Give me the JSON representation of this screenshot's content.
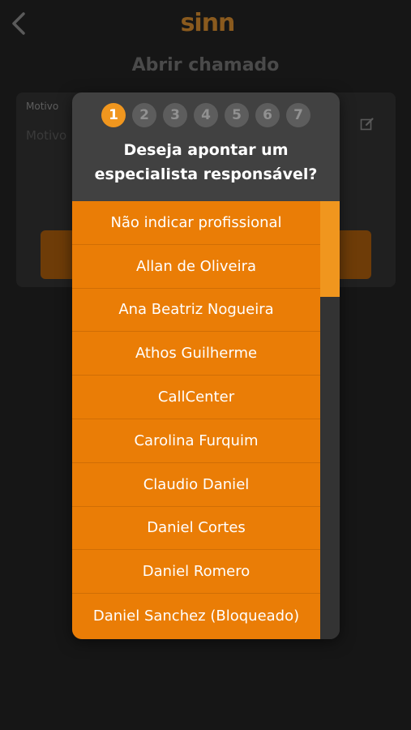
{
  "app": {
    "logo_text": "sinn",
    "page_title": "Abrir chamado"
  },
  "form": {
    "motivo_label": "Motivo",
    "motivo_placeholder": "Motivo"
  },
  "modal": {
    "steps": [
      {
        "label": "1",
        "active": true
      },
      {
        "label": "2",
        "active": false
      },
      {
        "label": "3",
        "active": false
      },
      {
        "label": "4",
        "active": false
      },
      {
        "label": "5",
        "active": false
      },
      {
        "label": "6",
        "active": false
      },
      {
        "label": "7",
        "active": false
      }
    ],
    "question_line1": "Deseja apontar um",
    "question_line2": "especialista responsável?",
    "options": [
      "Não indicar profissional",
      "Allan de Oliveira",
      "Ana Beatriz Nogueira",
      "Athos Guilherme",
      "CallCenter",
      "Carolina Furquim",
      "Claudio Daniel",
      "Daniel Cortes",
      "Daniel Romero",
      "Daniel Sanchez (Bloqueado)"
    ]
  },
  "colors": {
    "accent": "#ea7d06",
    "accent_light": "#f0961e",
    "background": "#161616",
    "modal_bg": "#414141"
  },
  "icons": {
    "back": "chevron-left-icon",
    "edit": "edit-icon"
  }
}
